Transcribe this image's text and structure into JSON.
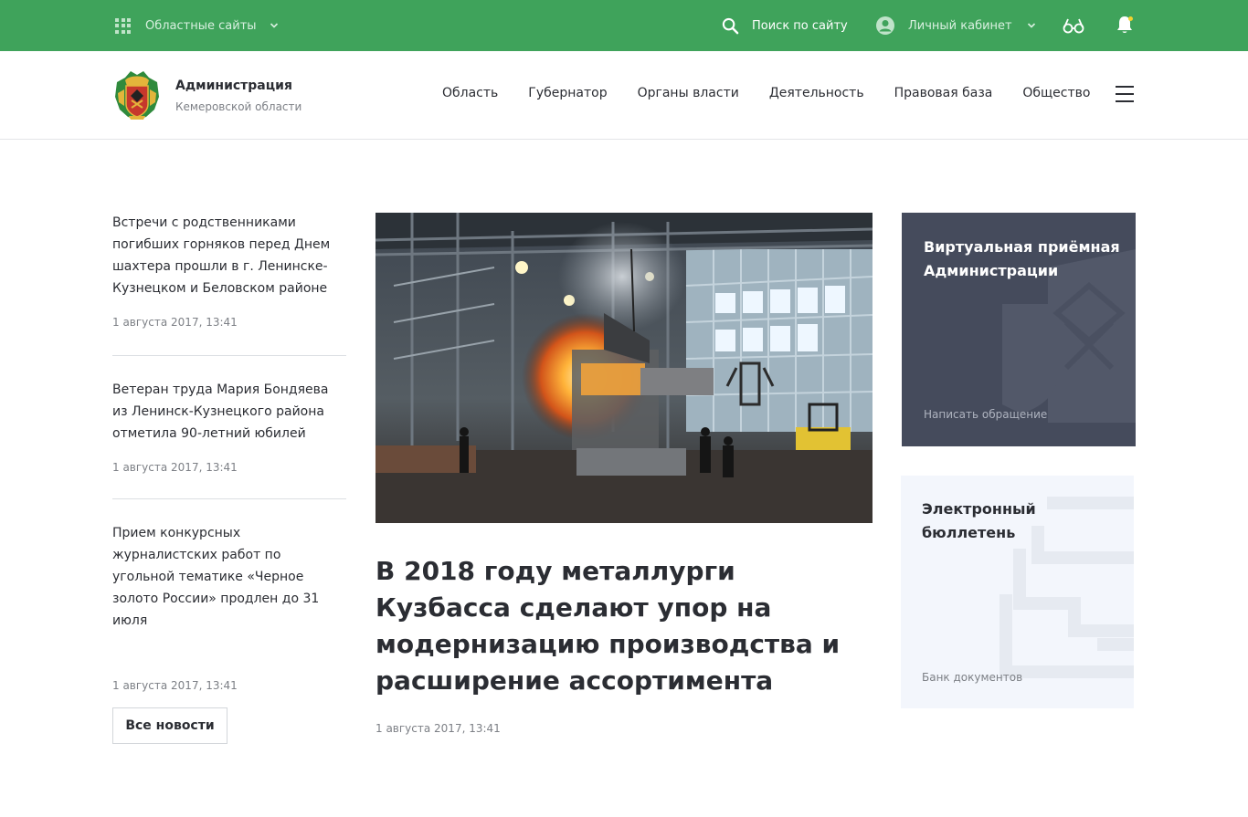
{
  "topbar": {
    "regions_label": "Областные сайты",
    "search_label": "Поиск по сайту",
    "cabinet_label": "Личный кабинет",
    "accent_color": "#3fa35b",
    "notification_dot_color": "#f2d22e"
  },
  "header": {
    "brand_title": "Администрация",
    "brand_subtitle": "Кемеровской области",
    "nav": [
      {
        "label": "Область"
      },
      {
        "label": "Губернатор"
      },
      {
        "label": "Органы власти"
      },
      {
        "label": "Деятельность"
      },
      {
        "label": "Правовая база"
      },
      {
        "label": "Общество"
      }
    ]
  },
  "news": {
    "items": [
      {
        "title": "Встречи с родственниками погибших горняков перед Днем шахтера прошли в г. Ленинске-Кузнецком и Беловском районе",
        "date": "1 августа 2017, 13:41"
      },
      {
        "title": "Ветеран труда Мария Бондяева из Ленинск-Кузнецкого района отметила 90-летний юбилей",
        "date": "1 августа 2017, 13:41"
      },
      {
        "title": "Прием конкурсных журналистских работ по угольной тематике «Черное золото России» продлен до 31 июля",
        "date": "1 августа 2017, 13:41"
      }
    ],
    "all_news_label": "Все новости"
  },
  "main_article": {
    "title": "В 2018 году металлурги Кузбасса сделают упор на модернизацию производства и расширение ассортимента",
    "date": "1 августа 2017, 13:41"
  },
  "cards": {
    "virtual": {
      "title": "Виртуальная приёмная Администрации",
      "link": "Написать обращение",
      "bg_color": "#454b5c"
    },
    "bulletin": {
      "title": "Электронный бюллетень",
      "link": "Банк документов",
      "bg_color": "#f3f6fc"
    }
  }
}
